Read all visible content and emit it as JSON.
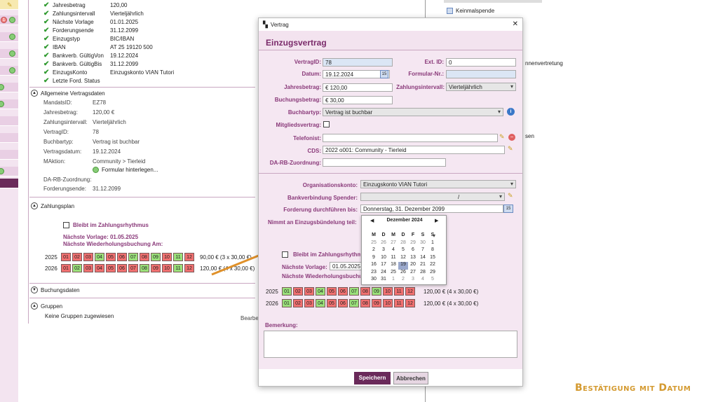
{
  "background_panel": {
    "bank_rows": [
      {
        "label": "Jahresbetrag",
        "value": "120,00"
      },
      {
        "label": "Zahlungsintervall",
        "value": "Vierteljährlich"
      },
      {
        "label": "Nächste Vorlage",
        "value": "01.01.2025"
      },
      {
        "label": "Forderungsende",
        "value": "31.12.2099"
      },
      {
        "label": "Einzugstyp",
        "value": "BIC/IBAN"
      },
      {
        "label": "IBAN",
        "value": "AT 25 19120 500"
      },
      {
        "label": "Bankverb. GültigVon",
        "value": "19.12.2024"
      },
      {
        "label": "Bankverb. GültigBis",
        "value": "31.12.2099"
      },
      {
        "label": "EinzugsKonto",
        "value": "Einzugskonto VIAN Tutori"
      },
      {
        "label": "Letzte Ford. Status",
        "value": ""
      }
    ],
    "allgemeine_title": "Allgemeine Vertragsdaten",
    "allgemeine_rows": [
      {
        "label": "MandatsID:",
        "value": "EZ78"
      },
      {
        "label": "Jahresbetrag:",
        "value": "120,00 €"
      },
      {
        "label": "Zahlungsintervall:",
        "value": "Vierteljährlich"
      },
      {
        "label": "VertragID:",
        "value": "78"
      },
      {
        "label": "Buchbartyp:",
        "value": "Vertrag ist buchbar"
      },
      {
        "label": "Vertragsdatum:",
        "value": "19.12.2024"
      },
      {
        "label": "MAktion:",
        "value": "Community   >   Tierleid"
      }
    ],
    "formular_link": "Formular hinterlegen...",
    "da_rb_label": "DA-RB-Zuordnung:",
    "forderungsende_label": "Forderungsende:",
    "forderungsende_value": "31.12.2099",
    "zahlungsplan_title": "Zahlungsplan",
    "bleibt_label": "Bleibt im Zahlungsrhythmus",
    "naechste_vorlage": "Nächste Vorlage:   01.05.2025",
    "naechste_wiederholung": "Nächste Wiederholungsbuchung Am:",
    "plan": [
      {
        "year": "2025",
        "colors": [
          "r",
          "r",
          "r",
          "g",
          "r",
          "r",
          "g",
          "r",
          "g",
          "r",
          "g",
          "r"
        ],
        "summary": "90,00 € (3 x 30,00 €)"
      },
      {
        "year": "2026",
        "colors": [
          "r",
          "g",
          "r",
          "r",
          "r",
          "r",
          "r",
          "g",
          "r",
          "r",
          "g",
          "r"
        ],
        "summary": "120,00 € (4 x 30,00 €)"
      }
    ],
    "buchungsdaten_title": "Buchungsdaten",
    "gruppen_title": "Gruppen",
    "gruppen_text": "Keine Gruppen zugewiesen",
    "bearbeiten_link": "Bearbe"
  },
  "right_panel": {
    "items": [
      "Keinmalspende"
    ],
    "fragments": [
      "nnenvertretung",
      "sen"
    ]
  },
  "dialog": {
    "window_title": "Vertrag",
    "close": "✕",
    "header": "Einzugsvertrag",
    "fields": {
      "vertragid_label": "VertragID:",
      "vertragid_value": "78",
      "extid_label": "Ext. ID:",
      "extid_value": "0",
      "datum_label": "Datum:",
      "datum_value": "19.12.2024",
      "formular_label": "Formular-Nr.:",
      "formular_value": "",
      "jahresbetrag_label": "Jahresbetrag:",
      "jahresbetrag_value": "€ 120,00",
      "zahlungsintervall_label": "Zahlungsintervall:",
      "zahlungsintervall_value": "Vierteljährlich",
      "buchungsbetrag_label": "Buchungsbetrag:",
      "buchungsbetrag_value": "€ 30,00",
      "buchbartyp_label": "Buchbartyp:",
      "buchbartyp_value": "Vertrag ist buchbar",
      "mitglied_label": "Mitgliedsvertrag:",
      "telefonist_label": "Telefonist:",
      "telefonist_value": "",
      "cds_label": "CDS:",
      "cds_value": "2022 o001: Community - Tierleid",
      "darb_label": "DA-RB-Zuordnung:",
      "darb_value": "",
      "orgkonto_label": "Organisationskonto:",
      "orgkonto_value": "Einzugskonto VIAN Tutori",
      "bankverb_label": "Bankverbindung Spender:",
      "bankverb_value": "/",
      "forderung_label": "Forderung durchführen bis:",
      "forderung_value": "Donnerstag, 31. Dezember 2099",
      "nimmt_label": "Nimmt an Einzugsbündelung teil:",
      "bleibt_label": "Bleibt im Zahlungsrhythmus",
      "naechste_vorlage_label": "Nächste Vorlage:",
      "naechste_vorlage_value": "01.05.2025",
      "naechste_wiederholung_label": "Nächste Wiederholungsbuchung",
      "bemerkung_label": "Bemerkung:"
    },
    "plan": [
      {
        "year": "2025",
        "colors": [
          "g",
          "r",
          "r",
          "g",
          "r",
          "r",
          "g",
          "r",
          "g",
          "r",
          "r",
          "r"
        ],
        "summary": "120,00 € (4 x 30,00 €)"
      },
      {
        "year": "2026",
        "colors": [
          "g",
          "r",
          "r",
          "g",
          "r",
          "r",
          "g",
          "r",
          "r",
          "r",
          "r",
          "r"
        ],
        "summary": "120,00 € (4 x 30,00 €)"
      }
    ],
    "save_button": "Speichern",
    "cancel_button": "Abbrechen"
  },
  "calendar": {
    "month": "Dezember 2024",
    "weekdays": [
      "M",
      "D",
      "M",
      "D",
      "F",
      "S",
      "S"
    ],
    "days": [
      [
        "25",
        "26",
        "27",
        "28",
        "29",
        "30",
        "1"
      ],
      [
        "2",
        "3",
        "4",
        "5",
        "6",
        "7",
        "8"
      ],
      [
        "9",
        "10",
        "11",
        "12",
        "13",
        "14",
        "15"
      ],
      [
        "16",
        "17",
        "18",
        "19",
        "20",
        "21",
        "22"
      ],
      [
        "23",
        "24",
        "25",
        "26",
        "27",
        "28",
        "29"
      ],
      [
        "30",
        "31",
        "1",
        "2",
        "3",
        "4",
        "5"
      ]
    ],
    "selected": "19"
  },
  "caption": "Bestätigung mit Datum",
  "accent_colors": {
    "purple": "#7a2a6a",
    "green": "#9ae07a",
    "red": "#f07070",
    "arrow": "#e0912a"
  }
}
